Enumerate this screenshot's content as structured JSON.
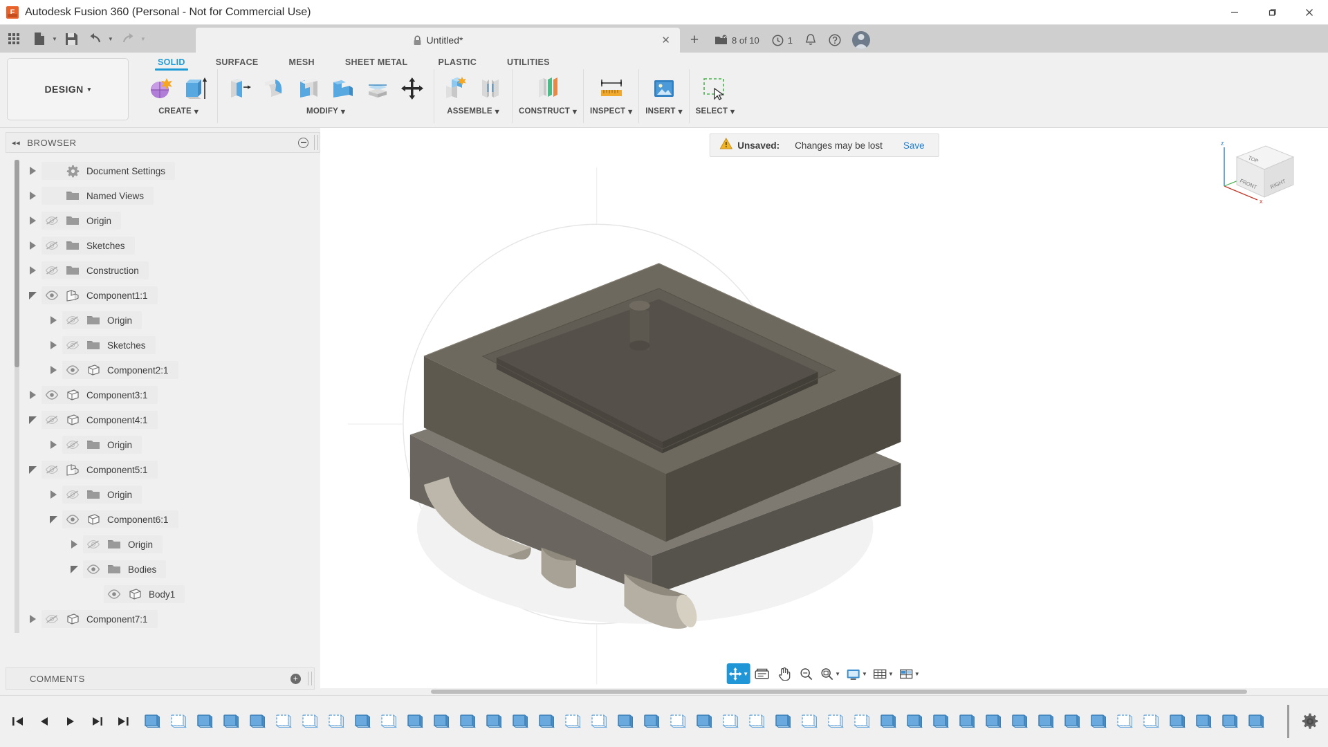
{
  "window": {
    "title": "Autodesk Fusion 360 (Personal - Not for Commercial Use)",
    "minimize": "–",
    "maximize": "❐",
    "close": "✕"
  },
  "quick_access": {
    "grid_icon": "app-grid-icon",
    "new_label": "new-document",
    "save_label": "save",
    "undo_label": "undo",
    "redo_label": "redo"
  },
  "tab": {
    "title": "Untitled*",
    "lock_icon": "lock-icon",
    "close": "✕",
    "new_tab": "+"
  },
  "status_right": {
    "jobs_text": "8 of 10",
    "history_text": "1",
    "notifications_icon": "bell-icon",
    "help_icon": "help-icon",
    "avatar_icon": "user-avatar"
  },
  "ribbon": {
    "workspace": "DESIGN",
    "workspace_caret": "▾",
    "tabs": [
      {
        "label": "SOLID",
        "active": true
      },
      {
        "label": "SURFACE",
        "active": false
      },
      {
        "label": "MESH",
        "active": false
      },
      {
        "label": "SHEET METAL",
        "active": false
      },
      {
        "label": "PLASTIC",
        "active": false
      },
      {
        "label": "UTILITIES",
        "active": false
      }
    ],
    "panels": [
      {
        "label": "CREATE",
        "caret": "▾",
        "icons": [
          "create-sketch-icon",
          "extrude-icon"
        ]
      },
      {
        "label": "MODIFY",
        "caret": "▾",
        "icons": [
          "press-pull-icon",
          "fillet-icon",
          "shell-icon",
          "combine-icon",
          "offset-face-icon",
          "move-copy-icon"
        ]
      },
      {
        "label": "ASSEMBLE",
        "caret": "▾",
        "icons": [
          "new-component-icon",
          "joint-icon"
        ]
      },
      {
        "label": "CONSTRUCT",
        "caret": "▾",
        "icons": [
          "offset-plane-icon"
        ]
      },
      {
        "label": "INSPECT",
        "caret": "▾",
        "icons": [
          "measure-icon"
        ]
      },
      {
        "label": "INSERT",
        "caret": "▾",
        "icons": [
          "insert-canvas-icon"
        ]
      },
      {
        "label": "SELECT",
        "caret": "▾",
        "icons": [
          "select-window-icon"
        ]
      }
    ]
  },
  "browser": {
    "title": "BROWSER",
    "collapse_icon": "collapse-left-icon",
    "minimize_icon": "minimize-icon",
    "tree": [
      {
        "label": "Document Settings",
        "indent": 0,
        "twisty": "closed",
        "eye": "none",
        "icon": "gear-icon"
      },
      {
        "label": "Named Views",
        "indent": 0,
        "twisty": "closed",
        "eye": "none",
        "icon": "folder-icon"
      },
      {
        "label": "Origin",
        "indent": 0,
        "twisty": "closed",
        "eye": "hidden",
        "icon": "folder-icon"
      },
      {
        "label": "Sketches",
        "indent": 0,
        "twisty": "closed",
        "eye": "hidden",
        "icon": "folder-icon"
      },
      {
        "label": "Construction",
        "indent": 0,
        "twisty": "closed",
        "eye": "hidden",
        "icon": "folder-icon"
      },
      {
        "label": "Component1:1",
        "indent": 0,
        "twisty": "open",
        "eye": "visible",
        "icon": "component-icon"
      },
      {
        "label": "Origin",
        "indent": 1,
        "twisty": "closed",
        "eye": "hidden",
        "icon": "folder-icon"
      },
      {
        "label": "Sketches",
        "indent": 1,
        "twisty": "closed",
        "eye": "hidden",
        "icon": "folder-icon"
      },
      {
        "label": "Component2:1",
        "indent": 1,
        "twisty": "closed",
        "eye": "visible",
        "icon": "body-icon"
      },
      {
        "label": "Component3:1",
        "indent": 0,
        "twisty": "closed",
        "eye": "visible",
        "icon": "body-icon"
      },
      {
        "label": "Component4:1",
        "indent": 0,
        "twisty": "open",
        "eye": "hidden",
        "icon": "body-icon"
      },
      {
        "label": "Origin",
        "indent": 1,
        "twisty": "closed",
        "eye": "hidden",
        "icon": "folder-icon"
      },
      {
        "label": "Component5:1",
        "indent": 0,
        "twisty": "open",
        "eye": "hidden",
        "icon": "component-icon"
      },
      {
        "label": "Origin",
        "indent": 1,
        "twisty": "closed",
        "eye": "hidden",
        "icon": "folder-icon"
      },
      {
        "label": "Component6:1",
        "indent": 1,
        "twisty": "open",
        "eye": "visible",
        "icon": "body-icon"
      },
      {
        "label": "Origin",
        "indent": 2,
        "twisty": "closed",
        "eye": "hidden",
        "icon": "folder-icon"
      },
      {
        "label": "Bodies",
        "indent": 2,
        "twisty": "open",
        "eye": "visible",
        "icon": "folder-icon"
      },
      {
        "label": "Body1",
        "indent": 3,
        "twisty": "none",
        "eye": "visible",
        "icon": "body-icon"
      },
      {
        "label": "Component7:1",
        "indent": 0,
        "twisty": "closed",
        "eye": "hidden",
        "icon": "body-icon"
      }
    ]
  },
  "comments": {
    "title": "COMMENTS",
    "add_icon": "add-comment-icon"
  },
  "canvas": {
    "unsaved": {
      "warning_icon": "warning-icon",
      "label": "Unsaved:",
      "message": "Changes may be lost",
      "save_label": "Save"
    },
    "viewcube": {
      "front": "FRONT",
      "top": "TOP",
      "right": "RIGHT",
      "axis_x": "x",
      "axis_y": "y",
      "axis_z": "z"
    },
    "nav_toolbar": [
      {
        "icon": "orbit-icon",
        "caret": "▾",
        "selected": true
      },
      {
        "icon": "display-settings-icon",
        "caret": "",
        "selected": false
      },
      {
        "icon": "pan-icon",
        "caret": "",
        "selected": false
      },
      {
        "icon": "zoom-icon",
        "caret": "",
        "selected": false
      },
      {
        "icon": "fit-icon",
        "caret": "▾",
        "selected": false
      },
      {
        "icon": "visual-style-icon",
        "caret": "▾",
        "selected": false
      },
      {
        "icon": "grid-snap-icon",
        "caret": "▾",
        "selected": false
      },
      {
        "icon": "viewports-icon",
        "caret": "▾",
        "selected": false
      }
    ]
  },
  "timeline": {
    "playback": [
      {
        "icon": "skip-to-start-icon"
      },
      {
        "icon": "step-back-icon"
      },
      {
        "icon": "play-icon"
      },
      {
        "icon": "step-forward-icon"
      },
      {
        "icon": "skip-to-end-icon"
      }
    ],
    "features": [
      {
        "icon": "sketch-feature-icon",
        "kind": "solid"
      },
      {
        "icon": "sketch-feature-icon",
        "kind": "sketch"
      },
      {
        "icon": "extrude-feature-icon",
        "kind": "solid"
      },
      {
        "icon": "extrude-feature-icon",
        "kind": "solid"
      },
      {
        "icon": "extrude-feature-icon",
        "kind": "solid"
      },
      {
        "icon": "joint-feature-icon",
        "kind": "sketch"
      },
      {
        "icon": "sketch-feature-icon",
        "kind": "sketch"
      },
      {
        "icon": "revolve-feature-icon",
        "kind": "sketch"
      },
      {
        "icon": "extrude-feature-icon",
        "kind": "solid"
      },
      {
        "icon": "sketch-feature-icon",
        "kind": "sketch"
      },
      {
        "icon": "fillet-feature-icon",
        "kind": "solid"
      },
      {
        "icon": "extrude-feature-icon",
        "kind": "solid"
      },
      {
        "icon": "extrude-feature-icon",
        "kind": "solid"
      },
      {
        "icon": "extrude-feature-icon",
        "kind": "solid"
      },
      {
        "icon": "extrude-feature-icon",
        "kind": "solid"
      },
      {
        "icon": "extrude-feature-icon",
        "kind": "solid"
      },
      {
        "icon": "joint-feature-icon",
        "kind": "sketch"
      },
      {
        "icon": "sketch-feature-icon",
        "kind": "sketch"
      },
      {
        "icon": "mirror-feature-icon",
        "kind": "solid"
      },
      {
        "icon": "extrude-feature-icon",
        "kind": "solid"
      },
      {
        "icon": "joint-feature-icon",
        "kind": "sketch"
      },
      {
        "icon": "component-feature-icon",
        "kind": "solid"
      },
      {
        "icon": "sketch-feature-icon",
        "kind": "sketch"
      },
      {
        "icon": "appearance-feature-icon",
        "kind": "sketch"
      },
      {
        "icon": "extrude-feature-icon",
        "kind": "solid"
      },
      {
        "icon": "joint-feature-icon",
        "kind": "sketch"
      },
      {
        "icon": "plane-feature-icon",
        "kind": "sketch"
      },
      {
        "icon": "revolve-feature-icon",
        "kind": "sketch"
      },
      {
        "icon": "extrude-feature-icon",
        "kind": "solid"
      },
      {
        "icon": "extrude-feature-icon",
        "kind": "solid"
      },
      {
        "icon": "extrude-feature-icon",
        "kind": "solid"
      },
      {
        "icon": "extrude-feature-icon",
        "kind": "solid"
      },
      {
        "icon": "extrude-feature-icon",
        "kind": "solid"
      },
      {
        "icon": "extrude-feature-icon",
        "kind": "solid"
      },
      {
        "icon": "extrude-feature-icon",
        "kind": "solid"
      },
      {
        "icon": "extrude-feature-icon",
        "kind": "solid"
      },
      {
        "icon": "extrude-feature-icon",
        "kind": "solid"
      },
      {
        "icon": "joint-feature-icon",
        "kind": "sketch"
      },
      {
        "icon": "sketch-feature-icon",
        "kind": "sketch"
      },
      {
        "icon": "chamfer-feature-icon",
        "kind": "solid"
      },
      {
        "icon": "extrude-feature-icon",
        "kind": "solid"
      },
      {
        "icon": "extrude-feature-icon",
        "kind": "solid"
      },
      {
        "icon": "extrude-feature-icon",
        "kind": "solid"
      }
    ],
    "settings_icon": "settings-gear-icon"
  },
  "colors": {
    "accent": "#1d9bd7",
    "warning": "#e9a93a",
    "link": "#1d7fd0",
    "brand_orange": "#e8622a",
    "model_body": "#6e695f",
    "model_metal": "#b0a89c"
  }
}
